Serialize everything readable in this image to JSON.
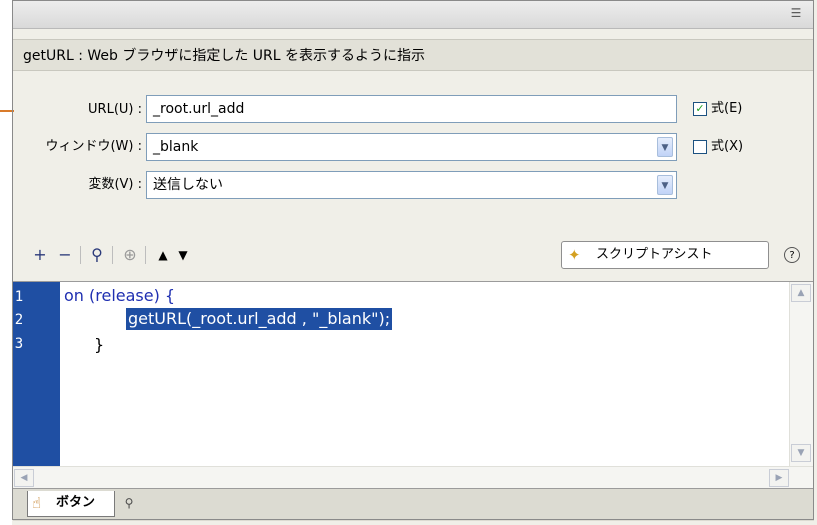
{
  "panel": {
    "description": "getURL : Web ブラウザに指定した URL を表示するように指示"
  },
  "params": {
    "url": {
      "label": "URL(U) :",
      "value": "_root.url_add",
      "checkbox_label": "式(E)",
      "checked": true
    },
    "window": {
      "label": "ウィンドウ(W) :",
      "value": "_blank",
      "checkbox_label": "式(X)",
      "checked": false
    },
    "variables": {
      "label": "変数(V) :",
      "value": "送信しない"
    }
  },
  "toolbar": {
    "add": "+",
    "remove": "−",
    "find": "⚲",
    "target": "⊕",
    "up": "▲",
    "down": "▼",
    "assist_label": "スクリプトアシスト",
    "help": "?"
  },
  "editor": {
    "line_numbers": [
      "1",
      "2",
      "3"
    ],
    "lines": [
      "on (release) {",
      "getURL(_root.url_add , \"_blank\");",
      "}"
    ]
  },
  "tabs": {
    "active_label": "ボタン"
  },
  "colors": {
    "accent": "#1f4fa3",
    "keyword": "#1f2fb1",
    "connector": "#d97b2a"
  },
  "icons": {
    "menu": "panel-menu-icon",
    "assist": "magic-wand-icon",
    "tab": "button-symbol-icon",
    "pin": "pin-icon"
  }
}
